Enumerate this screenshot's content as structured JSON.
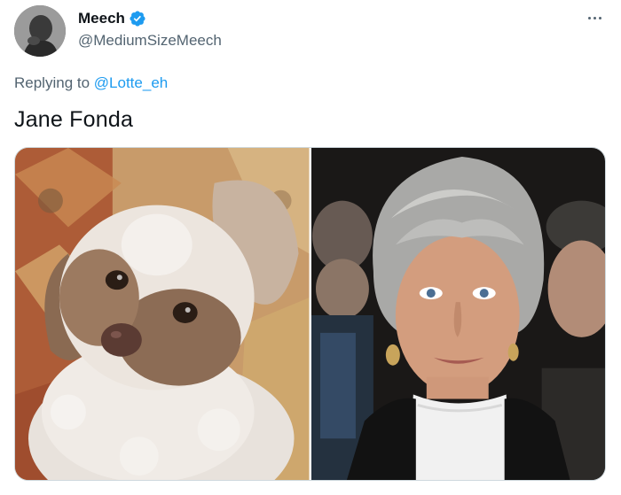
{
  "author": {
    "display_name": "Meech",
    "handle": "@MediumSizeMeech",
    "verified": true,
    "avatar_icon": "profile-avatar"
  },
  "reply": {
    "prefix": "Replying to",
    "to_handle": "@Lotte_eh"
  },
  "tweet": {
    "text": "Jane Fonda"
  },
  "media": [
    {
      "kind": "photo",
      "icon": "dog-photo"
    },
    {
      "kind": "photo",
      "icon": "woman-portrait-photo"
    }
  ],
  "colors": {
    "accent": "#1d9bf0",
    "secondary_text": "#536471",
    "primary_text": "#0f1419"
  }
}
